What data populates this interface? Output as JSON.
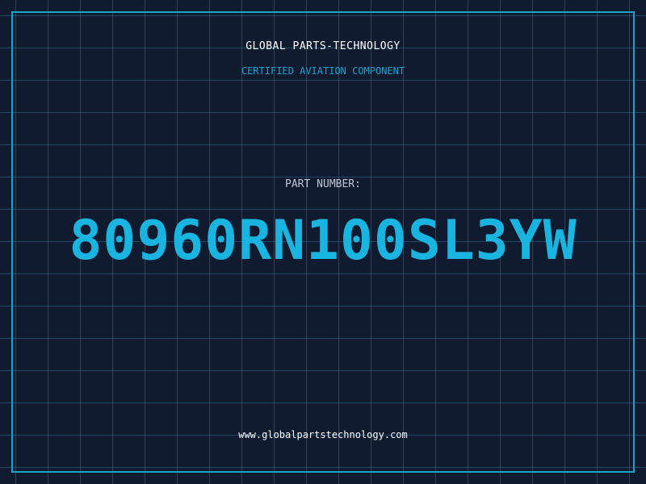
{
  "header": {
    "company": "GLOBAL PARTS-TECHNOLOGY",
    "tagline": "CERTIFIED AVIATION COMPONENT"
  },
  "part": {
    "label": "PART NUMBER:",
    "number": "80960RN100SL3YW"
  },
  "footer": {
    "website": "www.globalpartstechnology.com"
  },
  "colors": {
    "background": "#101b30",
    "accent": "#1aa3cf",
    "part_number": "#1ab4e0",
    "text": "#ffffff"
  }
}
